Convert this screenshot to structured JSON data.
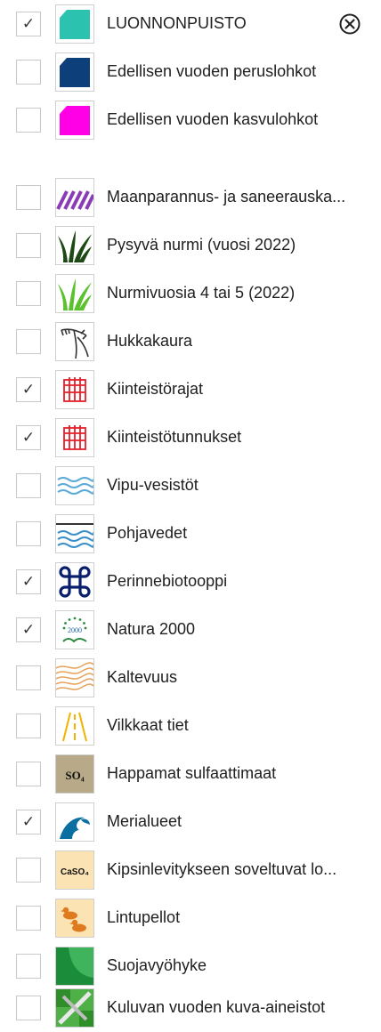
{
  "close_button_icon": "circle-x-icon",
  "layers": [
    {
      "label": "LUONNONPUISTO",
      "checked": true,
      "icon": "teal-polygon-icon"
    },
    {
      "label": "Edellisen vuoden peruslohkot",
      "checked": false,
      "icon": "navy-polygon-icon"
    },
    {
      "label": "Edellisen vuoden kasvulohkot",
      "checked": false,
      "icon": "magenta-polygon-icon"
    },
    {
      "label": "Maanparannus- ja saneerauska...",
      "checked": false,
      "icon": "purple-hatch-icon"
    },
    {
      "label": "Pysyvä nurmi (vuosi 2022)",
      "checked": false,
      "icon": "dark-grass-icon"
    },
    {
      "label": "Nurmivuosia 4 tai 5 (2022)",
      "checked": false,
      "icon": "green-grass-icon"
    },
    {
      "label": "Hukkakaura",
      "checked": false,
      "icon": "wild-oat-icon"
    },
    {
      "label": "Kiinteistörajat",
      "checked": true,
      "icon": "red-fence-icon"
    },
    {
      "label": "Kiinteistötunnukset",
      "checked": true,
      "icon": "red-fence-icon"
    },
    {
      "label": "Vipu-vesistöt",
      "checked": false,
      "icon": "water-waves-icon"
    },
    {
      "label": "Pohjavedet",
      "checked": false,
      "icon": "groundwater-icon"
    },
    {
      "label": "Perinnebiotooppi",
      "checked": true,
      "icon": "command-knot-icon"
    },
    {
      "label": "Natura 2000",
      "checked": true,
      "icon": "natura-2000-icon"
    },
    {
      "label": "Kaltevuus",
      "checked": false,
      "icon": "contour-lines-icon"
    },
    {
      "label": "Vilkkaat tiet",
      "checked": false,
      "icon": "road-icon"
    },
    {
      "label": "Happamat sulfaattimaat",
      "checked": false,
      "icon": "so4-icon"
    },
    {
      "label": "Merialueet",
      "checked": true,
      "icon": "sea-wave-icon"
    },
    {
      "label": "Kipsinlevitykseen soveltuvat lo...",
      "checked": false,
      "icon": "caso4-icon"
    },
    {
      "label": "Lintupellot",
      "checked": false,
      "icon": "ducks-icon"
    },
    {
      "label": "Suojavyöhyke",
      "checked": false,
      "icon": "buffer-zone-icon"
    },
    {
      "label": "Kuluvan vuoden kuva-aineistot",
      "checked": false,
      "icon": "aerial-image-icon"
    }
  ],
  "icon_texts": {
    "so4": "SO₄",
    "caso4": "CaSO₄",
    "natura": "2000"
  },
  "colors": {
    "teal": "#2bc3b0",
    "navy": "#0d3f7a",
    "magenta": "#ff00e6",
    "purple": "#8a3cb4",
    "red": "#e5202a",
    "water": "#5aa9d8",
    "sulfate_bg": "#b8aa88",
    "sea": "#0b6fa0"
  }
}
